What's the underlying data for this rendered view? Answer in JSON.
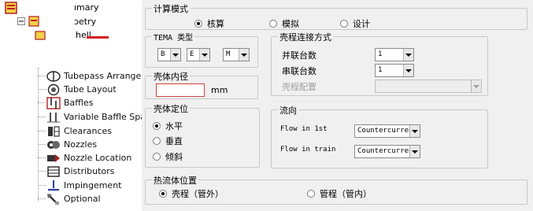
{
  "tree": {
    "top_items": [
      {
        "label": "ımary"
      },
      {
        "label": "ɔetry"
      },
      {
        "label": "hell"
      }
    ],
    "items": [
      {
        "label": "Tubepass Arrange",
        "icon": "tubepass-icon"
      },
      {
        "label": "Tube Layout",
        "icon": "tube-layout-icon"
      },
      {
        "label": "Baffles",
        "icon": "baffles-icon"
      },
      {
        "label": "Variable Baffle Spa",
        "icon": "variable-baffle-icon"
      },
      {
        "label": "Clearances",
        "icon": "clearances-icon"
      },
      {
        "label": "Nozzles",
        "icon": "nozzles-icon"
      },
      {
        "label": "Nozzle Location",
        "icon": "nozzle-location-icon"
      },
      {
        "label": "Distributors",
        "icon": "distributors-icon"
      },
      {
        "label": "Impingement",
        "icon": "impingement-icon"
      },
      {
        "label": "Optional",
        "icon": "optional-icon"
      }
    ]
  },
  "calc_mode": {
    "title": "计算模式",
    "options": [
      "核算",
      "模拟",
      "设计"
    ],
    "selected": 0
  },
  "tema": {
    "title": "TEMA 类型",
    "front": "B",
    "shell": "E",
    "rear": "M"
  },
  "shell_conn": {
    "title": "壳程连接方式",
    "parallel_label": "并联台数",
    "parallel_value": "1",
    "series_label": "串联台数",
    "series_value": "1",
    "arrangement_label": "壳程配置",
    "arrangement_value": ""
  },
  "shell_id": {
    "title": "壳体内径",
    "value": "",
    "unit": "mm"
  },
  "orientation": {
    "title": "壳体定位",
    "options": [
      "水平",
      "垂直",
      "倾斜"
    ],
    "selected": 0
  },
  "flow": {
    "title": "流向",
    "first_label": "Flow in 1st",
    "first_value": "Countercurrent",
    "train_label": "Flow in train",
    "train_value": "Countercurrent"
  },
  "hot_fluid": {
    "title": "热流体位置",
    "options": [
      "壳程（管外）",
      "管程（管内）"
    ],
    "selected": 0
  },
  "colors": {
    "panel_bg": "#f0f0f0",
    "accent_red": "#d42020"
  }
}
